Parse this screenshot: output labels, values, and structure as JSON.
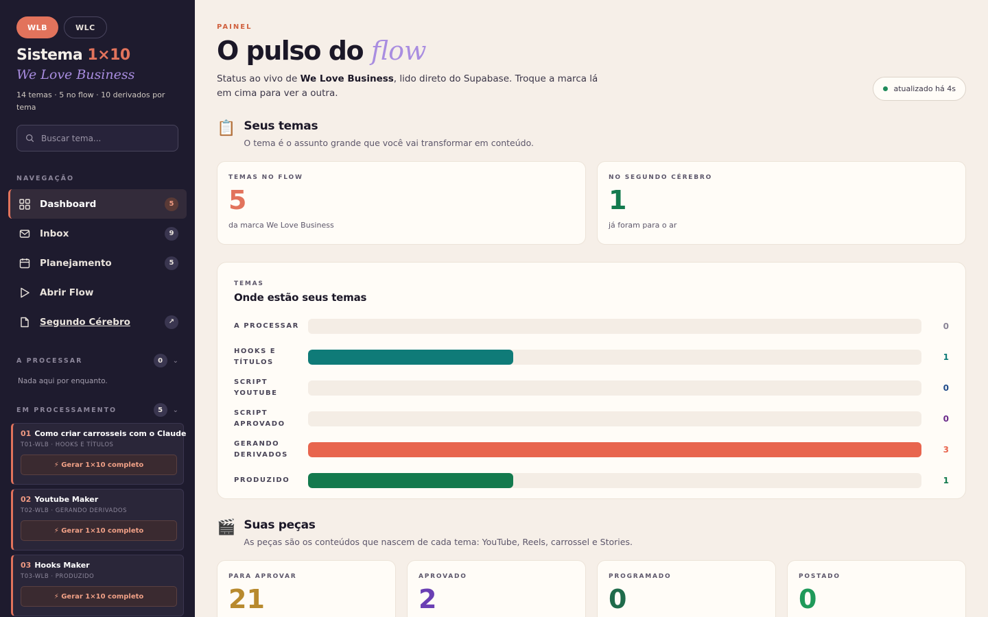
{
  "sidebar": {
    "brands": [
      "WLB",
      "WLC"
    ],
    "title_main": "Sistema",
    "title_accent": "1×10",
    "subtitle": "We Love Business",
    "meta": "14 temas · 5 no flow · 10 derivados por tema",
    "search_placeholder": "Buscar tema...",
    "nav_label": "NAVEGAÇÃO",
    "nav": [
      {
        "label": "Dashboard",
        "badge": "5",
        "icon": "grid-icon"
      },
      {
        "label": "Inbox",
        "badge": "9",
        "icon": "inbox-icon"
      },
      {
        "label": "Planejamento",
        "badge": "5",
        "icon": "calendar-icon"
      },
      {
        "label": "Abrir Flow",
        "badge": "",
        "icon": "play-icon"
      },
      {
        "label": "Segundo Cérebro",
        "badge": "↗",
        "icon": "document-icon"
      }
    ],
    "processar_label": "A PROCESSAR",
    "processar_count": "0",
    "processar_empty": "Nada aqui por enquanto.",
    "processando_label": "EM PROCESSAMENTO",
    "processando_count": "5",
    "cards": [
      {
        "num": "01",
        "title": "Como criar carrosseis com o Claude",
        "sub": "T01-WLB · HOOKS E TÍTULOS",
        "btn": "⚡ Gerar 1×10 completo"
      },
      {
        "num": "02",
        "title": "Youtube Maker",
        "sub": "T02-WLB · GERANDO DERIVADOS",
        "btn": "⚡ Gerar 1×10 completo"
      },
      {
        "num": "03",
        "title": "Hooks Maker",
        "sub": "T03-WLB · PRODUZIDO",
        "btn": "⚡ Gerar 1×10 completo"
      }
    ]
  },
  "main": {
    "eyebrow": "PAINEL",
    "headline": "O pulso do",
    "headline_accent": "flow",
    "lead_pre": "Status ao vivo de ",
    "lead_brand": "We Love Business",
    "lead_post": ", lido direto do Supabase. Troque a marca lá em cima para ver a outra.",
    "updated": "atualizado há 4s",
    "temas_title": "Seus temas",
    "temas_sub": "O tema é o assunto grande que você vai transformar em conteúdo.",
    "stats": [
      {
        "label": "TEMAS NO FLOW",
        "value": "5",
        "desc": "da marca We Love Business",
        "color": "#e2735c"
      },
      {
        "label": "NO SEGUNDO CÉREBRO",
        "value": "1",
        "desc": "já foram para o ar",
        "color": "#137a4e"
      }
    ],
    "panel_label": "TEMAS",
    "panel_title": "Onde estão seus temas",
    "pecas_title": "Suas peças",
    "pecas_sub": "As peças são os conteúdos que nascem de cada tema: YouTube, Reels, carrossel e Stories.",
    "pecas": [
      {
        "label": "PARA APROVAR",
        "value": "21",
        "color": "#b88a2e"
      },
      {
        "label": "APROVADO",
        "value": "2",
        "color": "#6a3fb3"
      },
      {
        "label": "PROGRAMADO",
        "value": "0",
        "color": "#1f6b4b"
      },
      {
        "label": "POSTADO",
        "value": "0",
        "color": "#1f9a5a"
      }
    ]
  },
  "chart_data": {
    "type": "bar",
    "categories": [
      "A PROCESSAR",
      "HOOKS E TÍTULOS",
      "SCRIPT YOUTUBE",
      "SCRIPT APROVADO",
      "GERANDO DERIVADOS",
      "PRODUZIDO"
    ],
    "values": [
      0,
      1,
      0,
      0,
      3,
      1
    ],
    "colors": [
      "#8a8496",
      "#0f7b78",
      "#1f4a8a",
      "#6a2a8a",
      "#e8654e",
      "#137a4e"
    ],
    "xlim": [
      0,
      3
    ],
    "title": "Onde estão seus temas"
  }
}
